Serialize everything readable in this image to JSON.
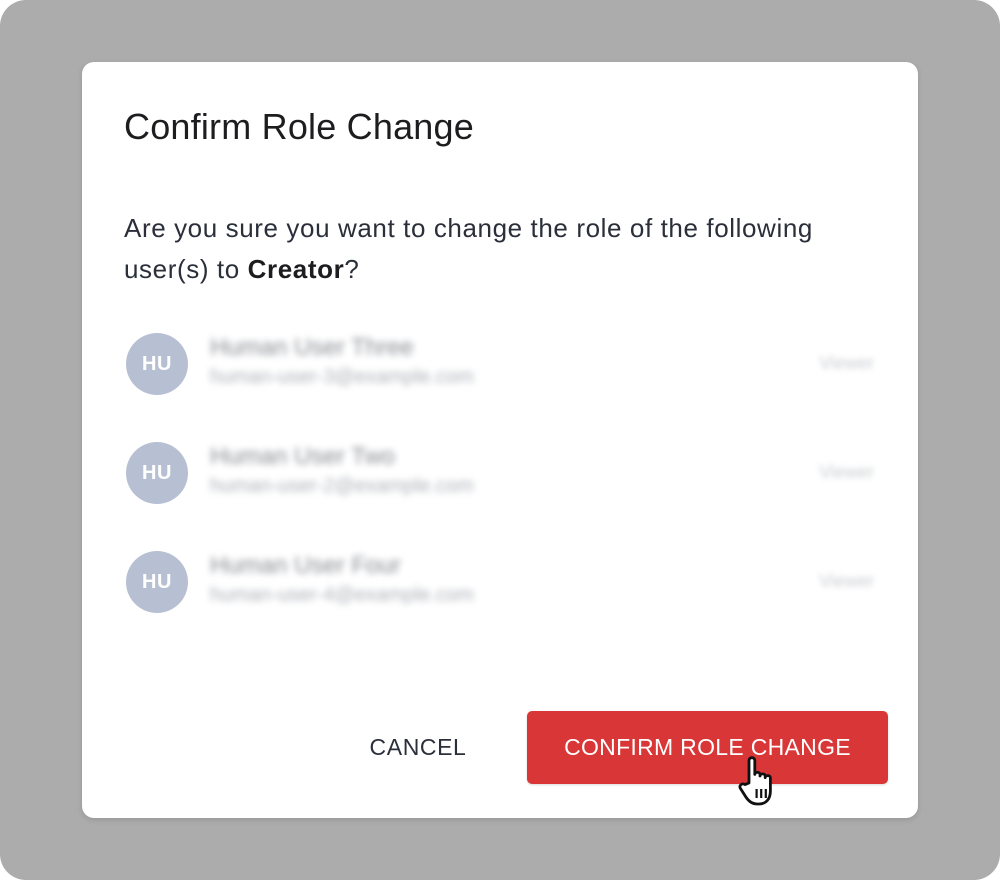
{
  "dialog": {
    "title": "Confirm Role Change",
    "message_prefix": "Are you sure you want to change the role of the following user(s) to ",
    "role": "Creator",
    "message_suffix": "?"
  },
  "users": [
    {
      "initials": "HU",
      "name": "Human User Three",
      "email": "human-user-3@example.com",
      "role": "Viewer"
    },
    {
      "initials": "HU",
      "name": "Human User Two",
      "email": "human-user-2@example.com",
      "role": "Viewer"
    },
    {
      "initials": "HU",
      "name": "Human User Four",
      "email": "human-user-4@example.com",
      "role": "Viewer"
    }
  ],
  "actions": {
    "cancel_label": "CANCEL",
    "confirm_label": "CONFIRM ROLE CHANGE"
  },
  "colors": {
    "backdrop": "#acacac",
    "danger": "#d93737",
    "avatar": "#b7c0d3"
  },
  "icons": {
    "cursor": "hand-pointer-icon"
  }
}
